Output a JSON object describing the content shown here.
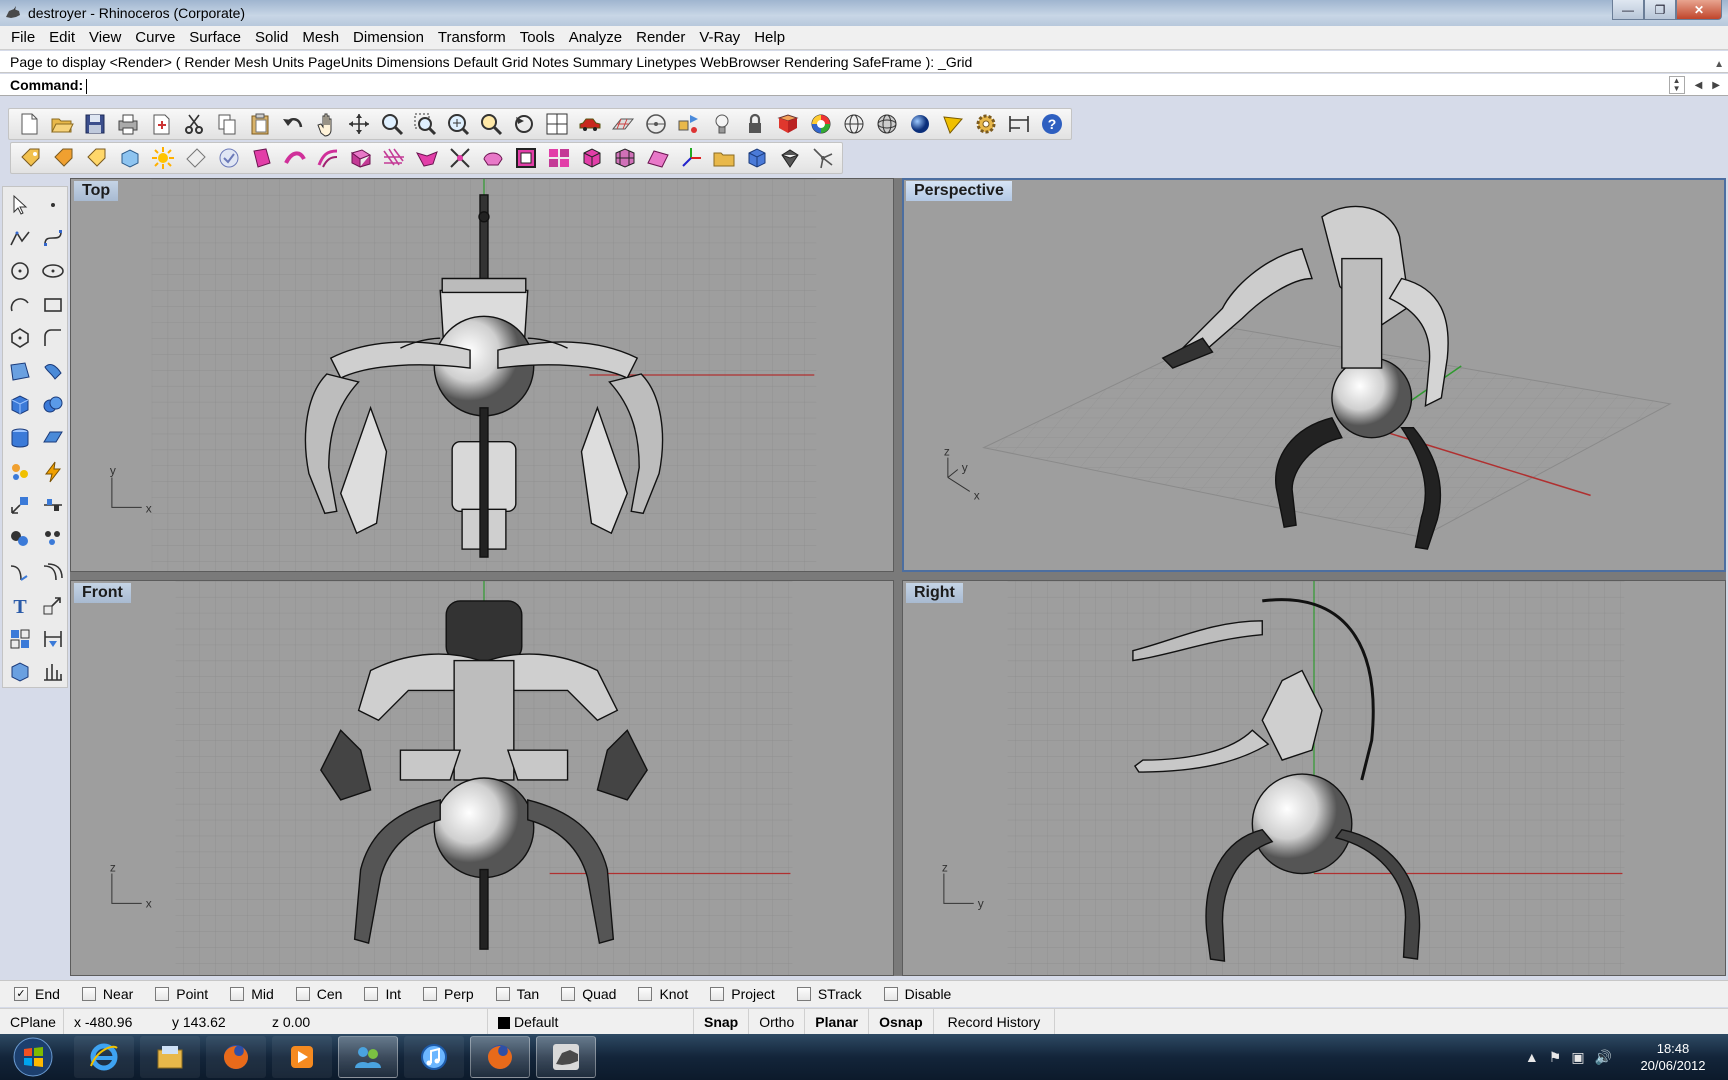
{
  "window": {
    "title": "destroyer - Rhinoceros (Corporate)"
  },
  "menu": [
    "File",
    "Edit",
    "View",
    "Curve",
    "Surface",
    "Solid",
    "Mesh",
    "Dimension",
    "Transform",
    "Tools",
    "Analyze",
    "Render",
    "V-Ray",
    "Help"
  ],
  "command_history": "Page to display <Render> ( Render  Mesh  Units  PageUnits  Dimensions  Default  Grid  Notes  Summary  Linetypes  WebBrowser  Rendering  SafeFrame ): _Grid",
  "command_prompt": "Command:",
  "viewports": {
    "top": {
      "title": "Top",
      "axis1": "y",
      "axis2": "x"
    },
    "perspective": {
      "title": "Perspective",
      "axis1": "z",
      "axis2": "y",
      "axis3": "x"
    },
    "front": {
      "title": "Front",
      "axis1": "z",
      "axis2": "x"
    },
    "right": {
      "title": "Right",
      "axis1": "z",
      "axis2": "y"
    }
  },
  "osnaps": [
    {
      "label": "End",
      "checked": true
    },
    {
      "label": "Near",
      "checked": false
    },
    {
      "label": "Point",
      "checked": false
    },
    {
      "label": "Mid",
      "checked": false
    },
    {
      "label": "Cen",
      "checked": false
    },
    {
      "label": "Int",
      "checked": false
    },
    {
      "label": "Perp",
      "checked": false
    },
    {
      "label": "Tan",
      "checked": false
    },
    {
      "label": "Quad",
      "checked": false
    },
    {
      "label": "Knot",
      "checked": false
    },
    {
      "label": "Project",
      "checked": false
    },
    {
      "label": "STrack",
      "checked": false
    },
    {
      "label": "Disable",
      "checked": false
    }
  ],
  "status": {
    "cplane": "CPlane",
    "x": "x -480.96",
    "y": "y 143.62",
    "z": "z 0.00",
    "layer": "Default",
    "snap": "Snap",
    "ortho": "Ortho",
    "planar": "Planar",
    "osnap": "Osnap",
    "record_history": "Record History"
  },
  "clock": {
    "time": "18:48",
    "date": "20/06/2012"
  },
  "colors": {
    "x_axis": "#b03030",
    "y_axis": "#2f9a2f",
    "grid_bg": "#9e9e9e",
    "active_viewport": "#4c6ea0"
  }
}
